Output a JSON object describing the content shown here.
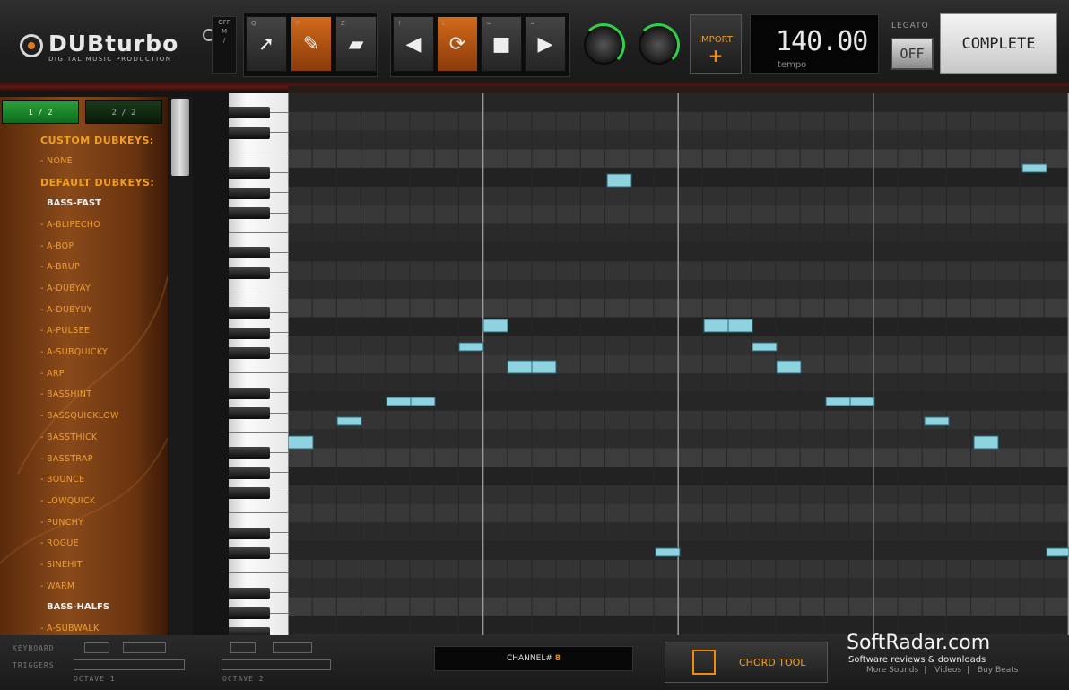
{
  "header": {
    "logo_title": "DUBturbo",
    "logo_subtitle": "DIGITAL MUSIC PRODUCTION",
    "mode_switch": [
      "OFF",
      "M",
      "/"
    ],
    "edit_tools": [
      {
        "key": "Q",
        "icon": "pointer-icon",
        "glyph": "➚"
      },
      {
        "key": "P",
        "icon": "pencil-icon",
        "glyph": "✎"
      },
      {
        "key": "Z",
        "icon": "eraser-icon",
        "glyph": "▰"
      }
    ],
    "transport": [
      {
        "key": "!",
        "icon": "rewind-icon",
        "glyph": "◀"
      },
      {
        "key": "L",
        "icon": "loop-icon",
        "glyph": "⟳"
      },
      {
        "key": "=",
        "icon": "stop-icon",
        "glyph": "■"
      },
      {
        "key": "=",
        "icon": "play-icon",
        "glyph": "▶"
      }
    ],
    "import_label": "IMPORT",
    "import_plus": "+",
    "tempo_value": "140.00",
    "tempo_label": "tempo",
    "legato_label": "LEGATO",
    "legato_value": "OFF",
    "complete_label": "COMPLETE"
  },
  "sidebar": {
    "page_buttons": [
      "1 / 2",
      "2 / 2"
    ],
    "rows": [
      {
        "type": "head",
        "text": "CUSTOM DUBKEYS:"
      },
      {
        "type": "item",
        "text": "- NONE"
      },
      {
        "type": "head",
        "text": "DEFAULT DUBKEYS:"
      },
      {
        "type": "cat",
        "text": "BASS-FAST"
      },
      {
        "type": "item",
        "text": "- A-BLIPECHO"
      },
      {
        "type": "item",
        "text": "- A-BOP"
      },
      {
        "type": "item",
        "text": "- A-BRUP"
      },
      {
        "type": "item",
        "text": "- A-DUBYAY"
      },
      {
        "type": "item",
        "text": "- A-DUBYUY"
      },
      {
        "type": "item",
        "text": "- A-PULSEE"
      },
      {
        "type": "item",
        "text": "- A-SUBQUICKY"
      },
      {
        "type": "item",
        "text": "- ARP"
      },
      {
        "type": "item",
        "text": "- BASSHINT"
      },
      {
        "type": "item",
        "text": "- BASSQUICKLOW"
      },
      {
        "type": "item",
        "text": "- BASSTHICK"
      },
      {
        "type": "item",
        "text": "- BASSTRAP"
      },
      {
        "type": "item",
        "text": "- BOUNCE"
      },
      {
        "type": "item",
        "text": "- LOWQUICK"
      },
      {
        "type": "item",
        "text": "- PUNCHY"
      },
      {
        "type": "item",
        "text": "- ROGUE"
      },
      {
        "type": "item",
        "text": "- SINEHIT"
      },
      {
        "type": "item",
        "text": "- WARM"
      },
      {
        "type": "cat",
        "text": "BASS-HALFS"
      },
      {
        "type": "item",
        "text": "- A-SUBWALK"
      }
    ]
  },
  "bottom": {
    "keyboard_label": "KEYBOARD",
    "triggers_label": "TRIGGERS",
    "octave1": "OCTAVE 1",
    "octave2": "OCTAVE 2",
    "channel_label": "CHANNEL#",
    "channel_value": "8",
    "chord_tool_label": "CHORD TOOL"
  },
  "watermark": {
    "title": "SoftRadar.com",
    "subtitle": "Software reviews & downloads",
    "links": [
      "More Sounds",
      "Videos",
      "Buy Beats"
    ]
  }
}
